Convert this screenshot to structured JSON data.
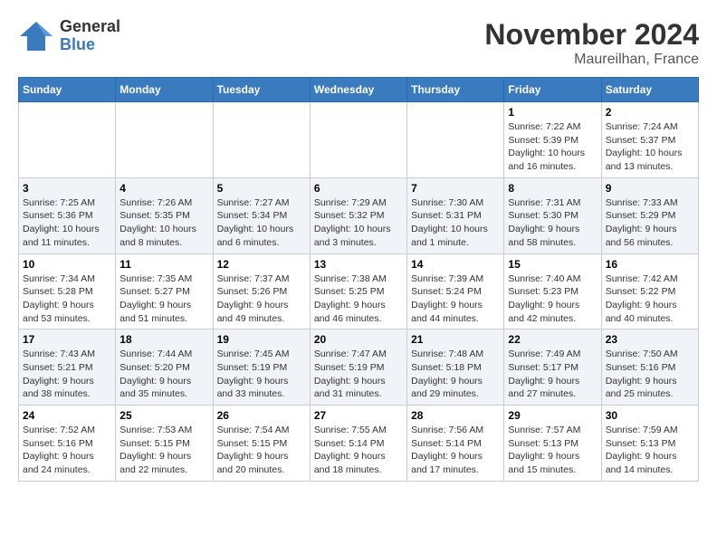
{
  "header": {
    "logo_general": "General",
    "logo_blue": "Blue",
    "title": "November 2024",
    "subtitle": "Maureilhan, France"
  },
  "weekdays": [
    "Sunday",
    "Monday",
    "Tuesday",
    "Wednesday",
    "Thursday",
    "Friday",
    "Saturday"
  ],
  "weeks": [
    [
      {
        "day": "",
        "info": ""
      },
      {
        "day": "",
        "info": ""
      },
      {
        "day": "",
        "info": ""
      },
      {
        "day": "",
        "info": ""
      },
      {
        "day": "",
        "info": ""
      },
      {
        "day": "1",
        "info": "Sunrise: 7:22 AM\nSunset: 5:39 PM\nDaylight: 10 hours and 16 minutes."
      },
      {
        "day": "2",
        "info": "Sunrise: 7:24 AM\nSunset: 5:37 PM\nDaylight: 10 hours and 13 minutes."
      }
    ],
    [
      {
        "day": "3",
        "info": "Sunrise: 7:25 AM\nSunset: 5:36 PM\nDaylight: 10 hours and 11 minutes."
      },
      {
        "day": "4",
        "info": "Sunrise: 7:26 AM\nSunset: 5:35 PM\nDaylight: 10 hours and 8 minutes."
      },
      {
        "day": "5",
        "info": "Sunrise: 7:27 AM\nSunset: 5:34 PM\nDaylight: 10 hours and 6 minutes."
      },
      {
        "day": "6",
        "info": "Sunrise: 7:29 AM\nSunset: 5:32 PM\nDaylight: 10 hours and 3 minutes."
      },
      {
        "day": "7",
        "info": "Sunrise: 7:30 AM\nSunset: 5:31 PM\nDaylight: 10 hours and 1 minute."
      },
      {
        "day": "8",
        "info": "Sunrise: 7:31 AM\nSunset: 5:30 PM\nDaylight: 9 hours and 58 minutes."
      },
      {
        "day": "9",
        "info": "Sunrise: 7:33 AM\nSunset: 5:29 PM\nDaylight: 9 hours and 56 minutes."
      }
    ],
    [
      {
        "day": "10",
        "info": "Sunrise: 7:34 AM\nSunset: 5:28 PM\nDaylight: 9 hours and 53 minutes."
      },
      {
        "day": "11",
        "info": "Sunrise: 7:35 AM\nSunset: 5:27 PM\nDaylight: 9 hours and 51 minutes."
      },
      {
        "day": "12",
        "info": "Sunrise: 7:37 AM\nSunset: 5:26 PM\nDaylight: 9 hours and 49 minutes."
      },
      {
        "day": "13",
        "info": "Sunrise: 7:38 AM\nSunset: 5:25 PM\nDaylight: 9 hours and 46 minutes."
      },
      {
        "day": "14",
        "info": "Sunrise: 7:39 AM\nSunset: 5:24 PM\nDaylight: 9 hours and 44 minutes."
      },
      {
        "day": "15",
        "info": "Sunrise: 7:40 AM\nSunset: 5:23 PM\nDaylight: 9 hours and 42 minutes."
      },
      {
        "day": "16",
        "info": "Sunrise: 7:42 AM\nSunset: 5:22 PM\nDaylight: 9 hours and 40 minutes."
      }
    ],
    [
      {
        "day": "17",
        "info": "Sunrise: 7:43 AM\nSunset: 5:21 PM\nDaylight: 9 hours and 38 minutes."
      },
      {
        "day": "18",
        "info": "Sunrise: 7:44 AM\nSunset: 5:20 PM\nDaylight: 9 hours and 35 minutes."
      },
      {
        "day": "19",
        "info": "Sunrise: 7:45 AM\nSunset: 5:19 PM\nDaylight: 9 hours and 33 minutes."
      },
      {
        "day": "20",
        "info": "Sunrise: 7:47 AM\nSunset: 5:19 PM\nDaylight: 9 hours and 31 minutes."
      },
      {
        "day": "21",
        "info": "Sunrise: 7:48 AM\nSunset: 5:18 PM\nDaylight: 9 hours and 29 minutes."
      },
      {
        "day": "22",
        "info": "Sunrise: 7:49 AM\nSunset: 5:17 PM\nDaylight: 9 hours and 27 minutes."
      },
      {
        "day": "23",
        "info": "Sunrise: 7:50 AM\nSunset: 5:16 PM\nDaylight: 9 hours and 25 minutes."
      }
    ],
    [
      {
        "day": "24",
        "info": "Sunrise: 7:52 AM\nSunset: 5:16 PM\nDaylight: 9 hours and 24 minutes."
      },
      {
        "day": "25",
        "info": "Sunrise: 7:53 AM\nSunset: 5:15 PM\nDaylight: 9 hours and 22 minutes."
      },
      {
        "day": "26",
        "info": "Sunrise: 7:54 AM\nSunset: 5:15 PM\nDaylight: 9 hours and 20 minutes."
      },
      {
        "day": "27",
        "info": "Sunrise: 7:55 AM\nSunset: 5:14 PM\nDaylight: 9 hours and 18 minutes."
      },
      {
        "day": "28",
        "info": "Sunrise: 7:56 AM\nSunset: 5:14 PM\nDaylight: 9 hours and 17 minutes."
      },
      {
        "day": "29",
        "info": "Sunrise: 7:57 AM\nSunset: 5:13 PM\nDaylight: 9 hours and 15 minutes."
      },
      {
        "day": "30",
        "info": "Sunrise: 7:59 AM\nSunset: 5:13 PM\nDaylight: 9 hours and 14 minutes."
      }
    ]
  ]
}
